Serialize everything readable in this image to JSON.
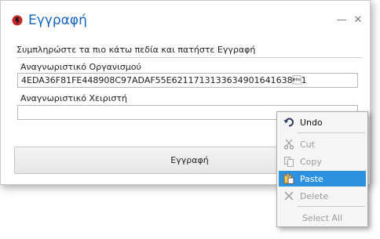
{
  "window": {
    "title": "Εγγραφή",
    "minimize_glyph": "—",
    "close_glyph": "✕",
    "instruction": "Συμπληρώστε τα πιο κάτω πεδία και πατήστε Εγγραφή",
    "org_id_label": "Αναγνωριστικό Οργανισμού",
    "org_id_value": "4EDA36F81FE448908C97ADAF55E6211713133634901641638\u00031",
    "user_id_label": "Αναγνωριστικό Χειριστή",
    "user_id_value": "",
    "register_label": "Εγγραφή"
  },
  "context_menu": {
    "items": [
      {
        "label": "Undo",
        "icon": "undo-icon",
        "enabled": true
      },
      {
        "label": "Cut",
        "icon": "scissors-icon",
        "enabled": false
      },
      {
        "label": "Copy",
        "icon": "copy-icon",
        "enabled": false
      },
      {
        "label": "Paste",
        "icon": "paste-icon",
        "enabled": true,
        "highlighted": true
      },
      {
        "label": "Delete",
        "icon": "delete-icon",
        "enabled": false
      },
      {
        "label": "Select All",
        "enabled": false
      }
    ]
  },
  "colors": {
    "title": "#1565c0",
    "highlight": "#2d93e0",
    "app_icon": "#c62828"
  }
}
